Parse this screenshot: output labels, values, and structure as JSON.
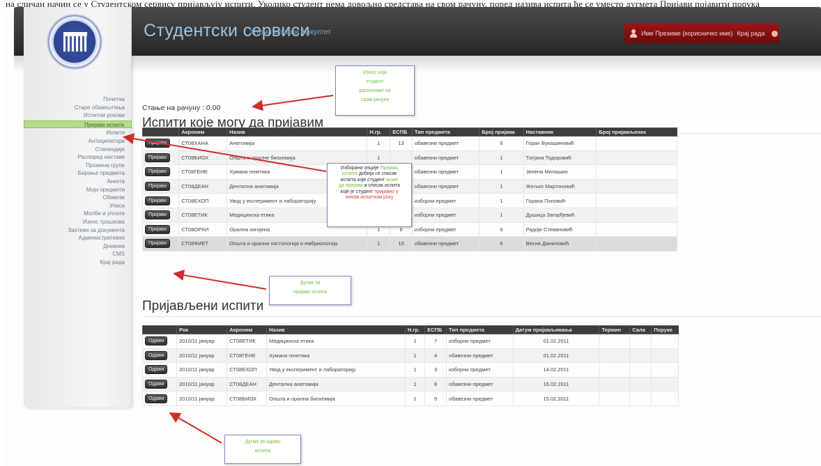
{
  "caption": "на сличан начин се у Студентском сервису пријављују испити. Уколико студент нема довољно средстава на свом рачуну, поред назива испита ће се уместо дугмета Пријави појавити порука",
  "header": {
    "title": "Студентски сервиси",
    "subtitle": "Стоматолошки факултет",
    "user_text": "Име Презиме (корисничко име)",
    "logout_label": "Крај рада"
  },
  "sidebar": {
    "items": [
      {
        "label": "Почетна"
      },
      {
        "label": "Старе обавештења"
      },
      {
        "label": "Испитни рокови"
      },
      {
        "label": "Пријава испита",
        "active": true
      },
      {
        "label": "Испити"
      },
      {
        "label": "Антиципатори"
      },
      {
        "label": "Стипендије"
      },
      {
        "label": "Распоред наставе"
      },
      {
        "label": "Промена групе"
      },
      {
        "label": "Бирање предмета"
      },
      {
        "label": "Анкета"
      },
      {
        "label": "Моји предмети"
      },
      {
        "label": "Обавезе"
      },
      {
        "label": "Уписи"
      },
      {
        "label": "Молбе и уплате"
      },
      {
        "label": "Износ трошкова"
      },
      {
        "label": "Захтеви за документа"
      },
      {
        "label": "Административно"
      },
      {
        "label": "Дневник"
      },
      {
        "label": "CMS"
      },
      {
        "label": "Крај рада"
      }
    ]
  },
  "balance_text": "Стање на рачуну : 0.00",
  "available": {
    "title": "Испити које могу да пријавим",
    "columns": [
      "",
      "Акроним",
      "Назив",
      "Н.гр.",
      "ЕСПБ",
      "Тип предмета",
      "Број пријава",
      "Наставник",
      "Број пријављених"
    ],
    "button_label": "Пријави",
    "rows": [
      [
        "СТ08ХАНА",
        "Анатомија",
        "1",
        "13",
        "обавезни предмет",
        "6",
        "Горан Вукашиновић"
      ],
      [
        "СТ08БИОХ",
        "Општа и оралне биохемија",
        "1",
        "",
        "обавезни предмет",
        "1",
        "Татјана Тодоровић"
      ],
      [
        "СТ08ГЕНЕ",
        "Хумана генетика",
        "",
        "",
        "обавезни предмет",
        "1",
        "Јелена Милашин"
      ],
      [
        "СТ08ДЕАН",
        "Дентална анатомија",
        "",
        "",
        "обавезни предмет",
        "1",
        "Жељко Мартиновић"
      ],
      [
        "СТ08ЕХОП",
        "Увод у експеримент и лабораторију",
        "",
        "",
        "изборни предмет",
        "1",
        "Горана Поповић"
      ],
      [
        "СТ08ЕТИК",
        "Медицинска етика",
        "",
        "",
        "изборни предмет",
        "1",
        "Душица Загорђевић"
      ],
      [
        "СТ08ОРХИ",
        "Орална хигијена",
        "1",
        "6",
        "изборни предмет",
        "6",
        "Радоје Стевановић"
      ],
      [
        "СТ08ФИЕТ",
        "Општа и орална хистологија и ембриологија",
        "1",
        "10",
        "обавезни предмет",
        "6",
        "Весна Даниловић"
      ]
    ]
  },
  "registered": {
    "title": "Пријављени испити",
    "columns": [
      "",
      "Рок",
      "Акроним",
      "Назив",
      "Н.гр.",
      "ЕСПБ",
      "Тип предмета",
      "Датум пријављивања",
      "Термин",
      "Сала",
      "Поруке"
    ],
    "button_label": "Одјави",
    "rows": [
      [
        "2010/11 јануар",
        "СТ08ЕТИК",
        "Медицинска етика",
        "1",
        "7",
        "изборни предмет",
        "01.02.2011"
      ],
      [
        "2010/11 јануар",
        "СТ08ГЕНЕ",
        "Хумана генетика",
        "1",
        "4",
        "обавезни предмет",
        "01.02.2011"
      ],
      [
        "2010/11 јануар",
        "СТ08ЕХОП",
        "Увод у експеримент и лабораторију",
        "1",
        "3",
        "изборни предмет",
        "14.02.2011"
      ],
      [
        "2010/11 јануар",
        "СТ08ДЕАН",
        "Дентална анатомија",
        "1",
        "8",
        "обавезни предмет",
        "16.02.2011"
      ],
      [
        "2010/11 јануар",
        "СТ08БИОХ",
        "Општа и орална биохемија",
        "1",
        "9",
        "обавезни предмет",
        "15.02.2011"
      ]
    ]
  },
  "notes": {
    "balance": {
      "l1": "Износ који",
      "l2": "студент",
      "l3": "располаже на",
      "l4": "свом рачуну"
    },
    "center": {
      "p1": "Изборани опције",
      "p2": "Пријава",
      "p3": "испита",
      "p4": "добија се списак",
      "p5": "испита које студент",
      "p6": "може",
      "p7": "да пријави",
      "p8": "и списак испита",
      "p9": "које је студент",
      "p10": "пријавио у",
      "p11": "неком испитном року"
    },
    "register": {
      "l1": "Дугме за",
      "l2": "пријаву испита"
    },
    "unregister": {
      "l1": "Дугме за одјаву",
      "l2": "испита"
    }
  },
  "colors": {
    "header_bg": "#2e2e2e",
    "title_blue": "#9bc3e2",
    "user_box": "#8a1212",
    "active_nav": "#b6dc8e",
    "arrow_red": "#d12b2b",
    "note_border": "#7d87c9"
  }
}
